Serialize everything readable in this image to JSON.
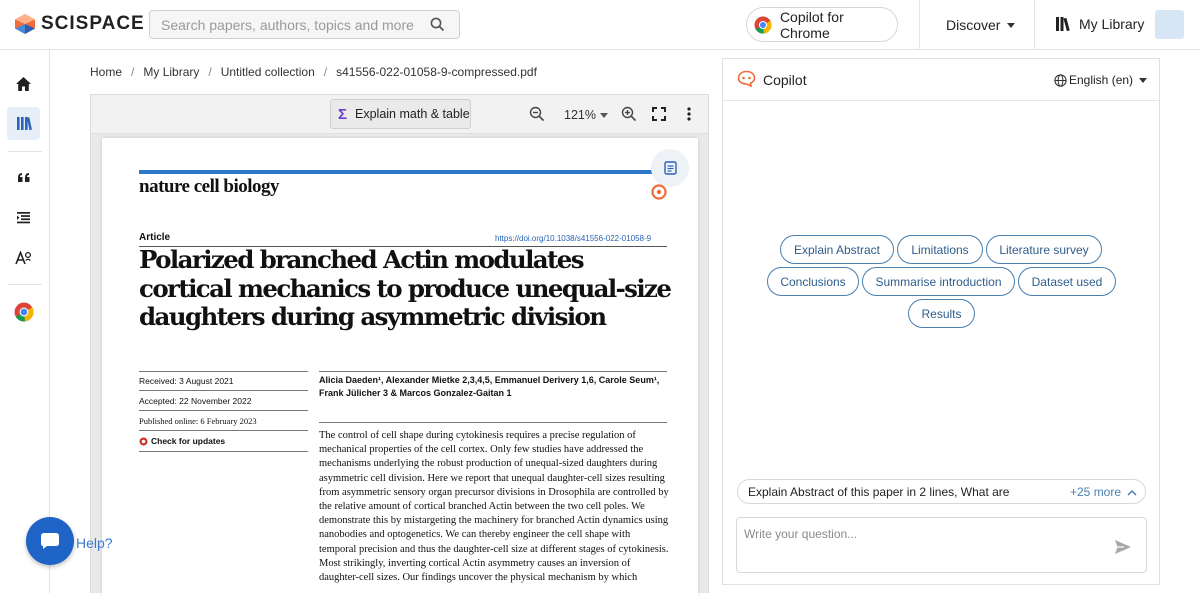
{
  "brand": {
    "name": "SCISPACE",
    "colors": {
      "orange": "#f26b3a",
      "blue": "#2a63b8",
      "chip_border": "#4a7fb1"
    }
  },
  "search": {
    "placeholder": "Search papers, authors, topics and more",
    "icon": "search-icon"
  },
  "header": {
    "copilot_chrome": "Copilot for Chrome",
    "discover": "Discover",
    "my_library": "My Library"
  },
  "sidebar": {
    "items": [
      {
        "name": "home",
        "icon": "home-icon"
      },
      {
        "name": "library",
        "icon": "library-icon",
        "active": true
      },
      {
        "name": "citation",
        "icon": "quote-icon"
      },
      {
        "name": "literature-review",
        "icon": "list-icon"
      },
      {
        "name": "paraphraser",
        "icon": "text-ai-icon"
      },
      {
        "name": "chrome-extension",
        "icon": "chrome-icon"
      }
    ]
  },
  "breadcrumb": [
    "Home",
    "My Library",
    "Untitled collection",
    "s41556-022-01058-9-compressed.pdf"
  ],
  "viewer": {
    "explain_label": "Explain math & table",
    "zoom": "121%"
  },
  "paper": {
    "journal": "nature cell biology",
    "article_label": "Article",
    "doi": "https://doi.org/10.1038/s41556-022-01058-9",
    "title": "Polarized branched Actin modulates cortical mechanics to produce unequal-size daughters during asymmetric division",
    "received": "Received: 3 August 2021",
    "accepted": "Accepted: 22 November 2022",
    "published": "Published online: 6 February 2023",
    "check_updates": "Check for updates",
    "authors": "Alicia Daeden¹, Alexander Mietke 2,3,4,5, Emmanuel Derivery 1,6, Carole Seum¹, Frank Jülicher 3 & Marcos Gonzalez-Gaitan 1",
    "abstract": "The control of cell shape during cytokinesis requires a precise regulation of mechanical properties of the cell cortex. Only few studies have addressed the mechanisms underlying the robust production of unequal-sized daughters during asymmetric cell division. Here we report that unequal daughter-cell sizes resulting from asymmetric sensory organ precursor divisions in Drosophila are controlled by the relative amount of cortical branched Actin between the two cell poles. We demonstrate this by mistargeting the machinery for branched Actin dynamics using nanobodies and optogenetics. We can thereby engineer the cell shape with temporal precision and thus the daughter-cell size at different stages of cytokinesis. Most strikingly, inverting cortical Actin asymmetry causes an inversion of daughter-cell sizes. Our findings uncover the physical mechanism by which"
  },
  "copilot": {
    "title": "Copilot",
    "language": "English (en)",
    "chips": [
      "Explain Abstract",
      "Limitations",
      "Literature survey",
      "Conclusions",
      "Summarise introduction",
      "Dataset used",
      "Results"
    ],
    "suggestion": "Explain Abstract of this paper in 2 lines, What are the",
    "more": "+25 more",
    "input_placeholder": "Write your question..."
  },
  "help": {
    "label": "Help?"
  }
}
